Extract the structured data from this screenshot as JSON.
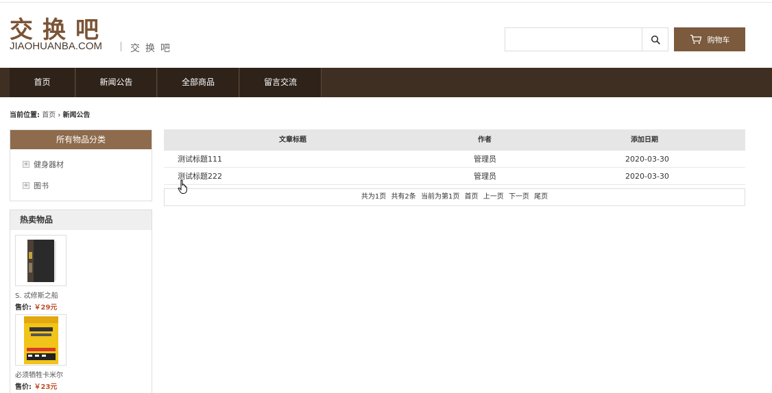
{
  "header": {
    "logo_cn": "交换吧",
    "logo_en": "JIAOHUANBA.COM",
    "logo_sub": "交换吧",
    "search_placeholder": "",
    "cart_label": "购物车"
  },
  "nav": {
    "items": [
      {
        "label": "首页"
      },
      {
        "label": "新闻公告"
      },
      {
        "label": "全部商品"
      },
      {
        "label": "留言交流"
      }
    ]
  },
  "breadcrumb": {
    "prefix": "当前位置:",
    "home": "首页",
    "sep": "›",
    "current": "新闻公告"
  },
  "categories": {
    "title": "所有物品分类",
    "items": [
      {
        "label": "健身器材"
      },
      {
        "label": "图书"
      }
    ]
  },
  "hot": {
    "title": "热卖物品",
    "price_label": "售价:",
    "items": [
      {
        "name": "S. 忒修斯之船",
        "price": "￥29元"
      },
      {
        "name": "必须牺牲卡米尔",
        "price": "￥23元"
      }
    ]
  },
  "news_table": {
    "columns": [
      "文章标题",
      "作者",
      "添加日期"
    ],
    "rows": [
      {
        "title": "测试标题111",
        "author": "管理员",
        "date": "2020-03-30"
      },
      {
        "title": "测试标题222",
        "author": "管理员",
        "date": "2020-03-30"
      }
    ],
    "pager": {
      "total_pages": "共为1页",
      "total_items": "共有2条",
      "current": "当前为第1页",
      "first": "首页",
      "prev": "上一页",
      "next": "下一页",
      "last": "尾页"
    }
  },
  "colors": {
    "brand": "#7b5a3d",
    "nav_bg": "#3e2f22",
    "category_head": "#8d6b4c",
    "price": "#c1502a"
  }
}
